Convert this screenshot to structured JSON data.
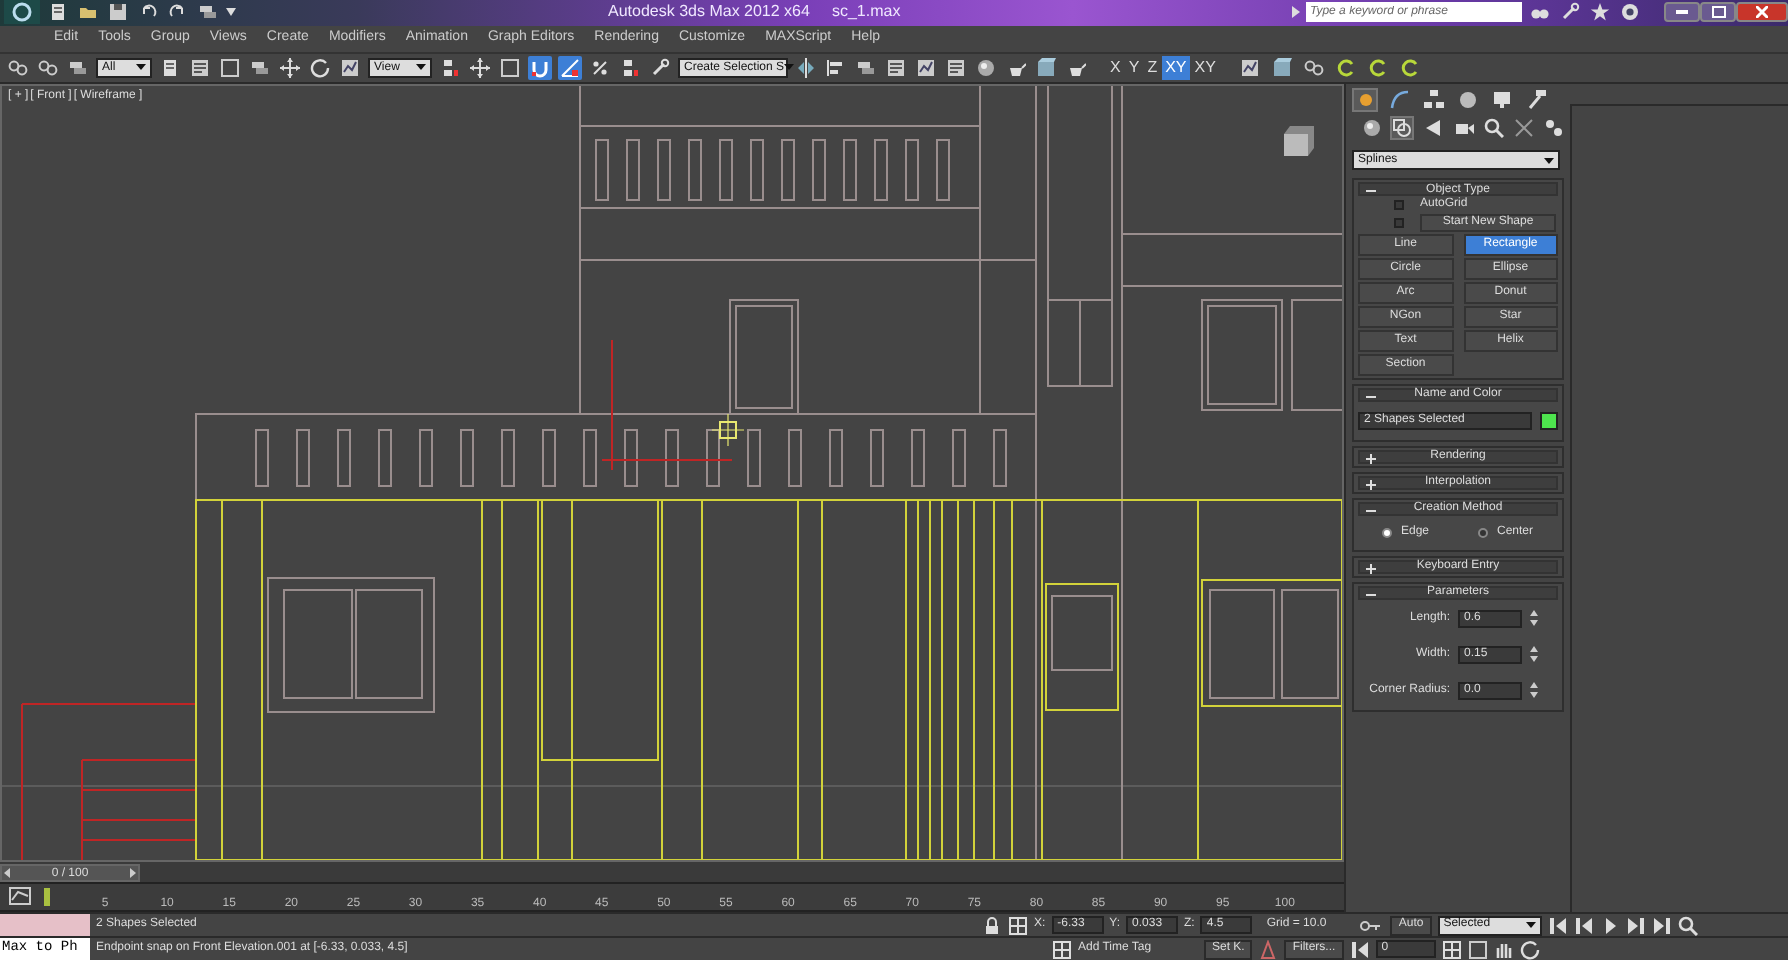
{
  "title_bar": {
    "app_title": "Autodesk 3ds Max  2012 x64",
    "file_name": "sc_1.max",
    "search": {
      "placeholder": "Type a keyword or phrase"
    }
  },
  "menu": [
    "Edit",
    "Tools",
    "Group",
    "Views",
    "Create",
    "Modifiers",
    "Animation",
    "Graph Editors",
    "Rendering",
    "Customize",
    "MAXScript",
    "Help"
  ],
  "toolbar": {
    "selection_filter": "All",
    "reference_coordinate": "View",
    "named_selection": "Create Selection S",
    "snaps": [
      {
        "selected": true
      },
      {
        "selected": true
      },
      {
        "selected": false
      },
      {
        "selected": false
      }
    ],
    "axes": [
      {
        "label": "X",
        "selected": false
      },
      {
        "label": "Y",
        "selected": false
      },
      {
        "label": "Z",
        "selected": false
      },
      {
        "label": "XY",
        "selected": true
      },
      {
        "label": "XY",
        "selected": false
      }
    ]
  },
  "viewport": {
    "labels": [
      "[ + ]",
      "[ Front ]",
      "[ Wireframe ]"
    ]
  },
  "command_panel": {
    "tabs": [
      {
        "selected": true
      },
      {
        "selected": false
      },
      {
        "selected": false
      },
      {
        "selected": false
      },
      {
        "selected": false
      },
      {
        "selected": false
      }
    ],
    "categories": [
      {
        "selected": false
      },
      {
        "selected": true
      },
      {
        "selected": false
      },
      {
        "selected": false
      },
      {
        "selected": false
      },
      {
        "selected": false
      },
      {
        "selected": false
      }
    ],
    "category_dropdown": "Splines",
    "rollouts": [
      {
        "kind": "object_type",
        "title": "Object Type",
        "expanded": true,
        "checks": [
          {
            "label": "AutoGrid",
            "checked": false
          },
          {
            "label": "Start New Shape",
            "checked": false
          }
        ],
        "buttons": [
          {
            "label": "Line",
            "selected": false
          },
          {
            "label": "Rectangle",
            "selected": true
          },
          {
            "label": "Circle",
            "selected": false
          },
          {
            "label": "Ellipse",
            "selected": false
          },
          {
            "label": "Arc",
            "selected": false
          },
          {
            "label": "Donut",
            "selected": false
          },
          {
            "label": "NGon",
            "selected": false
          },
          {
            "label": "Star",
            "selected": false
          },
          {
            "label": "Text",
            "selected": false
          },
          {
            "label": "Helix",
            "selected": false
          },
          {
            "label": "Section",
            "selected": false
          }
        ]
      },
      {
        "kind": "name_color",
        "title": "Name and Color",
        "expanded": true,
        "name": "2 Shapes Selected",
        "color": "#4ee44e"
      },
      {
        "kind": "plain",
        "title": "Rendering",
        "expanded": false
      },
      {
        "kind": "plain",
        "title": "Interpolation",
        "expanded": false
      },
      {
        "kind": "radios",
        "title": "Creation Method",
        "expanded": true,
        "options": [
          {
            "label": "Edge",
            "selected": true
          },
          {
            "label": "Center",
            "selected": false
          }
        ]
      },
      {
        "kind": "plain",
        "title": "Keyboard Entry",
        "expanded": false
      },
      {
        "kind": "spinners",
        "title": "Parameters",
        "expanded": true,
        "fields": [
          {
            "label": "Length:",
            "value": "0.6"
          },
          {
            "label": "Width:",
            "value": "0.15"
          },
          {
            "label": "Corner Radius:",
            "value": "0.0"
          }
        ]
      }
    ]
  },
  "time_slider": {
    "label": "0 / 100",
    "level": 0
  },
  "track_bar": {
    "ticks": [
      "5",
      "10",
      "15",
      "20",
      "25",
      "30",
      "35",
      "40",
      "45",
      "50",
      "55",
      "60",
      "65",
      "70",
      "75",
      "80",
      "85",
      "90",
      "95",
      "100"
    ]
  },
  "status": {
    "listener": "Max to Ph",
    "selection": "2 Shapes Selected",
    "prompt": "Endpoint snap on Front Elevation.001 at [-6.33, 0.033, 4.5]",
    "coords": [
      {
        "label": "X:",
        "value": "-6.33"
      },
      {
        "label": "Y:",
        "value": "0.033"
      },
      {
        "label": "Z:",
        "value": "4.5"
      }
    ],
    "grid": "Grid = 10.0",
    "add_time_tag": "Add Time Tag"
  },
  "animation": {
    "auto_key": "Auto",
    "key_mode": "Selected",
    "set_key": "Set K.",
    "filters": "Filters...",
    "frame": "0"
  }
}
